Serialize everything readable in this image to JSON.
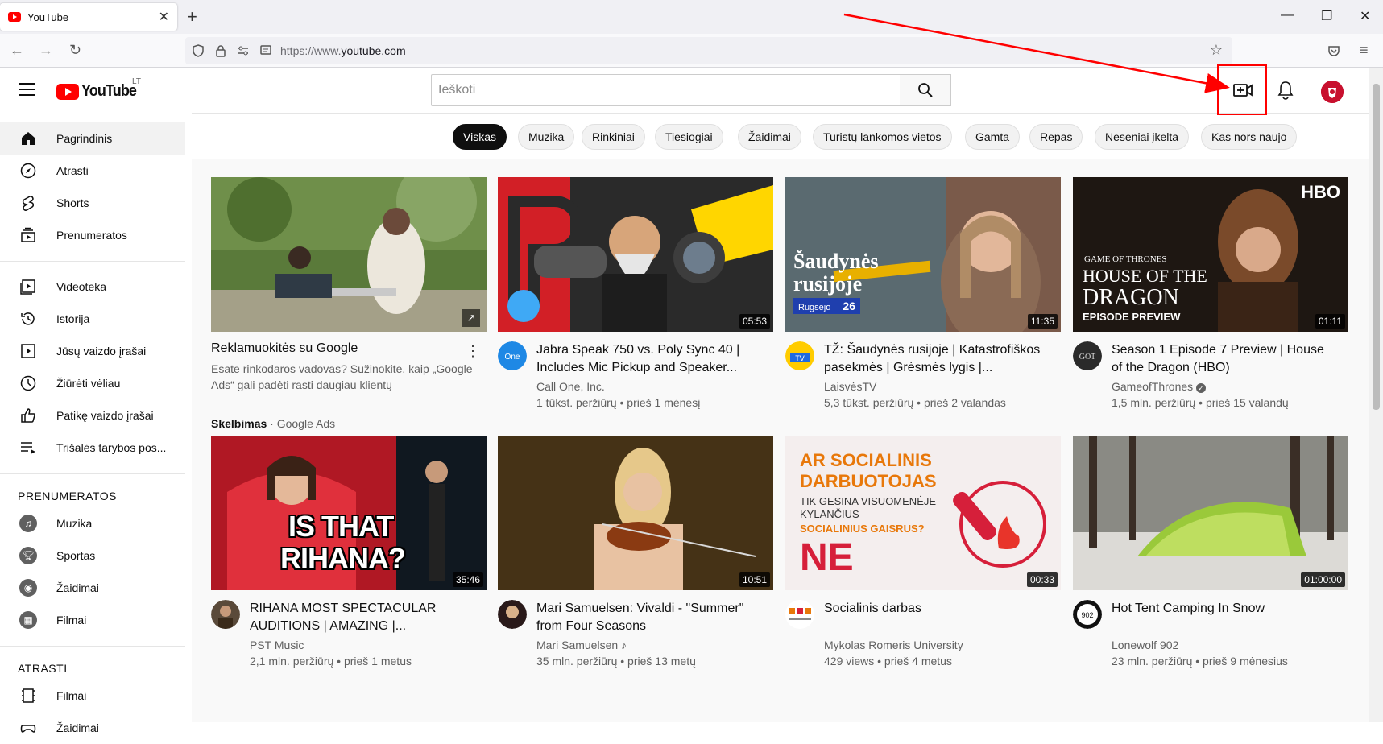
{
  "browser": {
    "tab_title": "YouTube",
    "url_host": "https://www.",
    "url_domain": "youtube.com"
  },
  "header": {
    "logo_text": "YouTube",
    "region": "LT",
    "search_placeholder": "Ieškoti"
  },
  "sidebar": {
    "main": [
      {
        "label": "Pagrindinis",
        "icon": "home-icon"
      },
      {
        "label": "Atrasti",
        "icon": "compass-icon"
      },
      {
        "label": "Shorts",
        "icon": "shorts-icon"
      },
      {
        "label": "Prenumeratos",
        "icon": "subscriptions-icon"
      }
    ],
    "library": [
      {
        "label": "Videoteka",
        "icon": "library-icon"
      },
      {
        "label": "Istorija",
        "icon": "history-icon"
      },
      {
        "label": "Jūsų vaizdo įrašai",
        "icon": "your-videos-icon"
      },
      {
        "label": "Žiūrėti vėliau",
        "icon": "watch-later-icon"
      },
      {
        "label": "Patikę vaizdo įrašai",
        "icon": "like-icon"
      },
      {
        "label": "Trišalės tarybos pos...",
        "icon": "playlist-icon"
      }
    ],
    "subscriptions_heading": "PRENUMERATOS",
    "subscriptions": [
      {
        "label": "Muzika",
        "icon": "music-icon"
      },
      {
        "label": "Sportas",
        "icon": "trophy-icon"
      },
      {
        "label": "Žaidimai",
        "icon": "gaming-icon"
      },
      {
        "label": "Filmai",
        "icon": "film-icon"
      }
    ],
    "explore_heading": "ATRASTI",
    "explore": [
      {
        "label": "Filmai",
        "icon": "film-strip-icon"
      },
      {
        "label": "Žaidimai",
        "icon": "gaming-icon"
      }
    ]
  },
  "chips": [
    "Viskas",
    "Muzika",
    "Rinkiniai",
    "Tiesiogiai",
    "Žaidimai",
    "Turistų lankomos vietos",
    "Gamta",
    "Repas",
    "Neseniai įkelta",
    "Kas nors naujo"
  ],
  "ad": {
    "title": "Reklamuokitės su Google",
    "description": "Esate rinkodaros vadovas? Sužinokite, kaip „Google Ads“ gali padėti rasti daugiau klientų",
    "badge": "Skelbimas",
    "advertiser": "Google Ads"
  },
  "videos": [
    {
      "title": "Jabra Speak 750 vs. Poly Sync 40 | Includes Mic Pickup and Speaker...",
      "channel": "Call One, Inc.",
      "meta": "1 tūkst. peržiūrų • prieš 1 mėnesį",
      "duration": "05:53"
    },
    {
      "title": "TŽ: Šaudynės rusijoje | Katastrofiškos pasekmės | Grėsmės lygis |...",
      "channel": "LaisvėsTV",
      "meta": "5,3 tūkst. peržiūrų • prieš 2 valandas",
      "duration": "11:35",
      "overlay_line1": "Šaudynės",
      "overlay_line2": "rusijoje",
      "overlay_tag": "Rugsėjo",
      "overlay_day": "26"
    },
    {
      "title": "Season 1 Episode 7 Preview | House of the Dragon (HBO)",
      "channel": "GameofThrones",
      "meta": "1,5 mln. peržiūrų • prieš 15 valandų",
      "duration": "01:11",
      "overlay_brand": "HBO",
      "overlay_got": "GAME OF THRONES",
      "overlay_house": "HOUSE OF THE",
      "overlay_dragon": "DRAGON",
      "overlay_preview": "EPISODE PREVIEW"
    },
    {
      "title": "RIHANA MOST SPECTACULAR AUDITIONS | AMAZING |...",
      "channel": "PST Music",
      "meta": "2,1 mln. peržiūrų • prieš 1 metus",
      "duration": "35:46",
      "overlay_line1": "IS THAT",
      "overlay_line2": "RIHANA?"
    },
    {
      "title": "Mari Samuelsen: Vivaldi - \"Summer\" from Four Seasons",
      "channel": "Mari Samuelsen",
      "meta": "35 mln. peržiūrų • prieš 13 metų",
      "duration": "10:51"
    },
    {
      "title": "Socialinis darbas",
      "channel": "Mykolas Romeris University",
      "meta": "429 views • prieš 4 metus",
      "duration": "00:33",
      "overlay_line1": "AR SOCIALINIS",
      "overlay_line2": "DARBUOTOJAS",
      "overlay_line3": "TIK GESINA VISUOMENĖJE",
      "overlay_line4": "KYLANČIUS",
      "overlay_line5": "SOCIALINIUS GAISRUS?",
      "overlay_no": "NE"
    },
    {
      "title": "Hot Tent Camping In Snow",
      "channel": "Lonewolf 902",
      "meta": "23 mln. peržiūrų • prieš 9 mėnesius",
      "duration": "01:00:00"
    }
  ],
  "colors": {
    "brand_red": "#ff0000",
    "annotation_red": "#ff0000",
    "chip_active": "#0f0f0f"
  }
}
